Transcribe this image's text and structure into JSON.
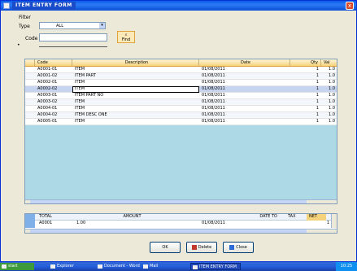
{
  "window": {
    "title": "ITEM ENTRY FORM",
    "close_label": "x"
  },
  "filter": {
    "group_label": "Filter",
    "field1_label": "Type",
    "field1_value": "ALL",
    "field2_label": "Code",
    "field2_value": "",
    "bullet": "•",
    "search_label": "Find"
  },
  "grid": {
    "columns": [
      "",
      "Code",
      "Description",
      "Date",
      "Qty",
      "Val"
    ],
    "rows": [
      {
        "num": "",
        "code": "A0001-01",
        "desc": "ITEM",
        "date": "01/08/2011",
        "qty": "1",
        "val": "1.0"
      },
      {
        "num": "",
        "code": "A0001-02",
        "desc": "ITEM PART",
        "date": "01/08/2011",
        "qty": "1",
        "val": "1.0"
      },
      {
        "num": "",
        "code": "A0002-01",
        "desc": "ITEM",
        "date": "01/08/2011",
        "qty": "1",
        "val": "1.0"
      },
      {
        "num": "",
        "code": "A0002-02",
        "desc": "ITEM",
        "date": "01/08/2011",
        "qty": "1",
        "val": "1.0"
      },
      {
        "num": "",
        "code": "A0003-01",
        "desc": "ITEM PART NO",
        "date": "01/08/2011",
        "qty": "1",
        "val": "1.0"
      },
      {
        "num": "",
        "code": "A0003-02",
        "desc": "ITEM",
        "date": "01/08/2011",
        "qty": "1",
        "val": "1.0"
      },
      {
        "num": "",
        "code": "A0004-01",
        "desc": "ITEM",
        "date": "01/08/2011",
        "qty": "1",
        "val": "1.0"
      },
      {
        "num": "",
        "code": "A0004-02",
        "desc": "ITEM DESC ONE",
        "date": "01/08/2011",
        "qty": "1",
        "val": "1.0"
      },
      {
        "num": "",
        "code": "A0005-01",
        "desc": "ITEM",
        "date": "01/08/2011",
        "qty": "1",
        "val": "1.0"
      }
    ],
    "selected_index": 3
  },
  "summary": {
    "col1_header": "TOTAL",
    "col2_header": "AMOUNT",
    "col3_header": "DATE TO",
    "col4_header": "TAX",
    "col5_header": "NET",
    "row_code": "A0001",
    "row_value": "1.00",
    "row_date": "01/08/2011",
    "row_net": "1"
  },
  "buttons": {
    "ok": "OK",
    "delete": "Delete",
    "close": "Close"
  },
  "taskbar": {
    "items": [
      "start",
      "Explorer",
      "Document - Word",
      "Mail",
      "ITEM ENTRY FORM"
    ],
    "clock": "10:25"
  }
}
